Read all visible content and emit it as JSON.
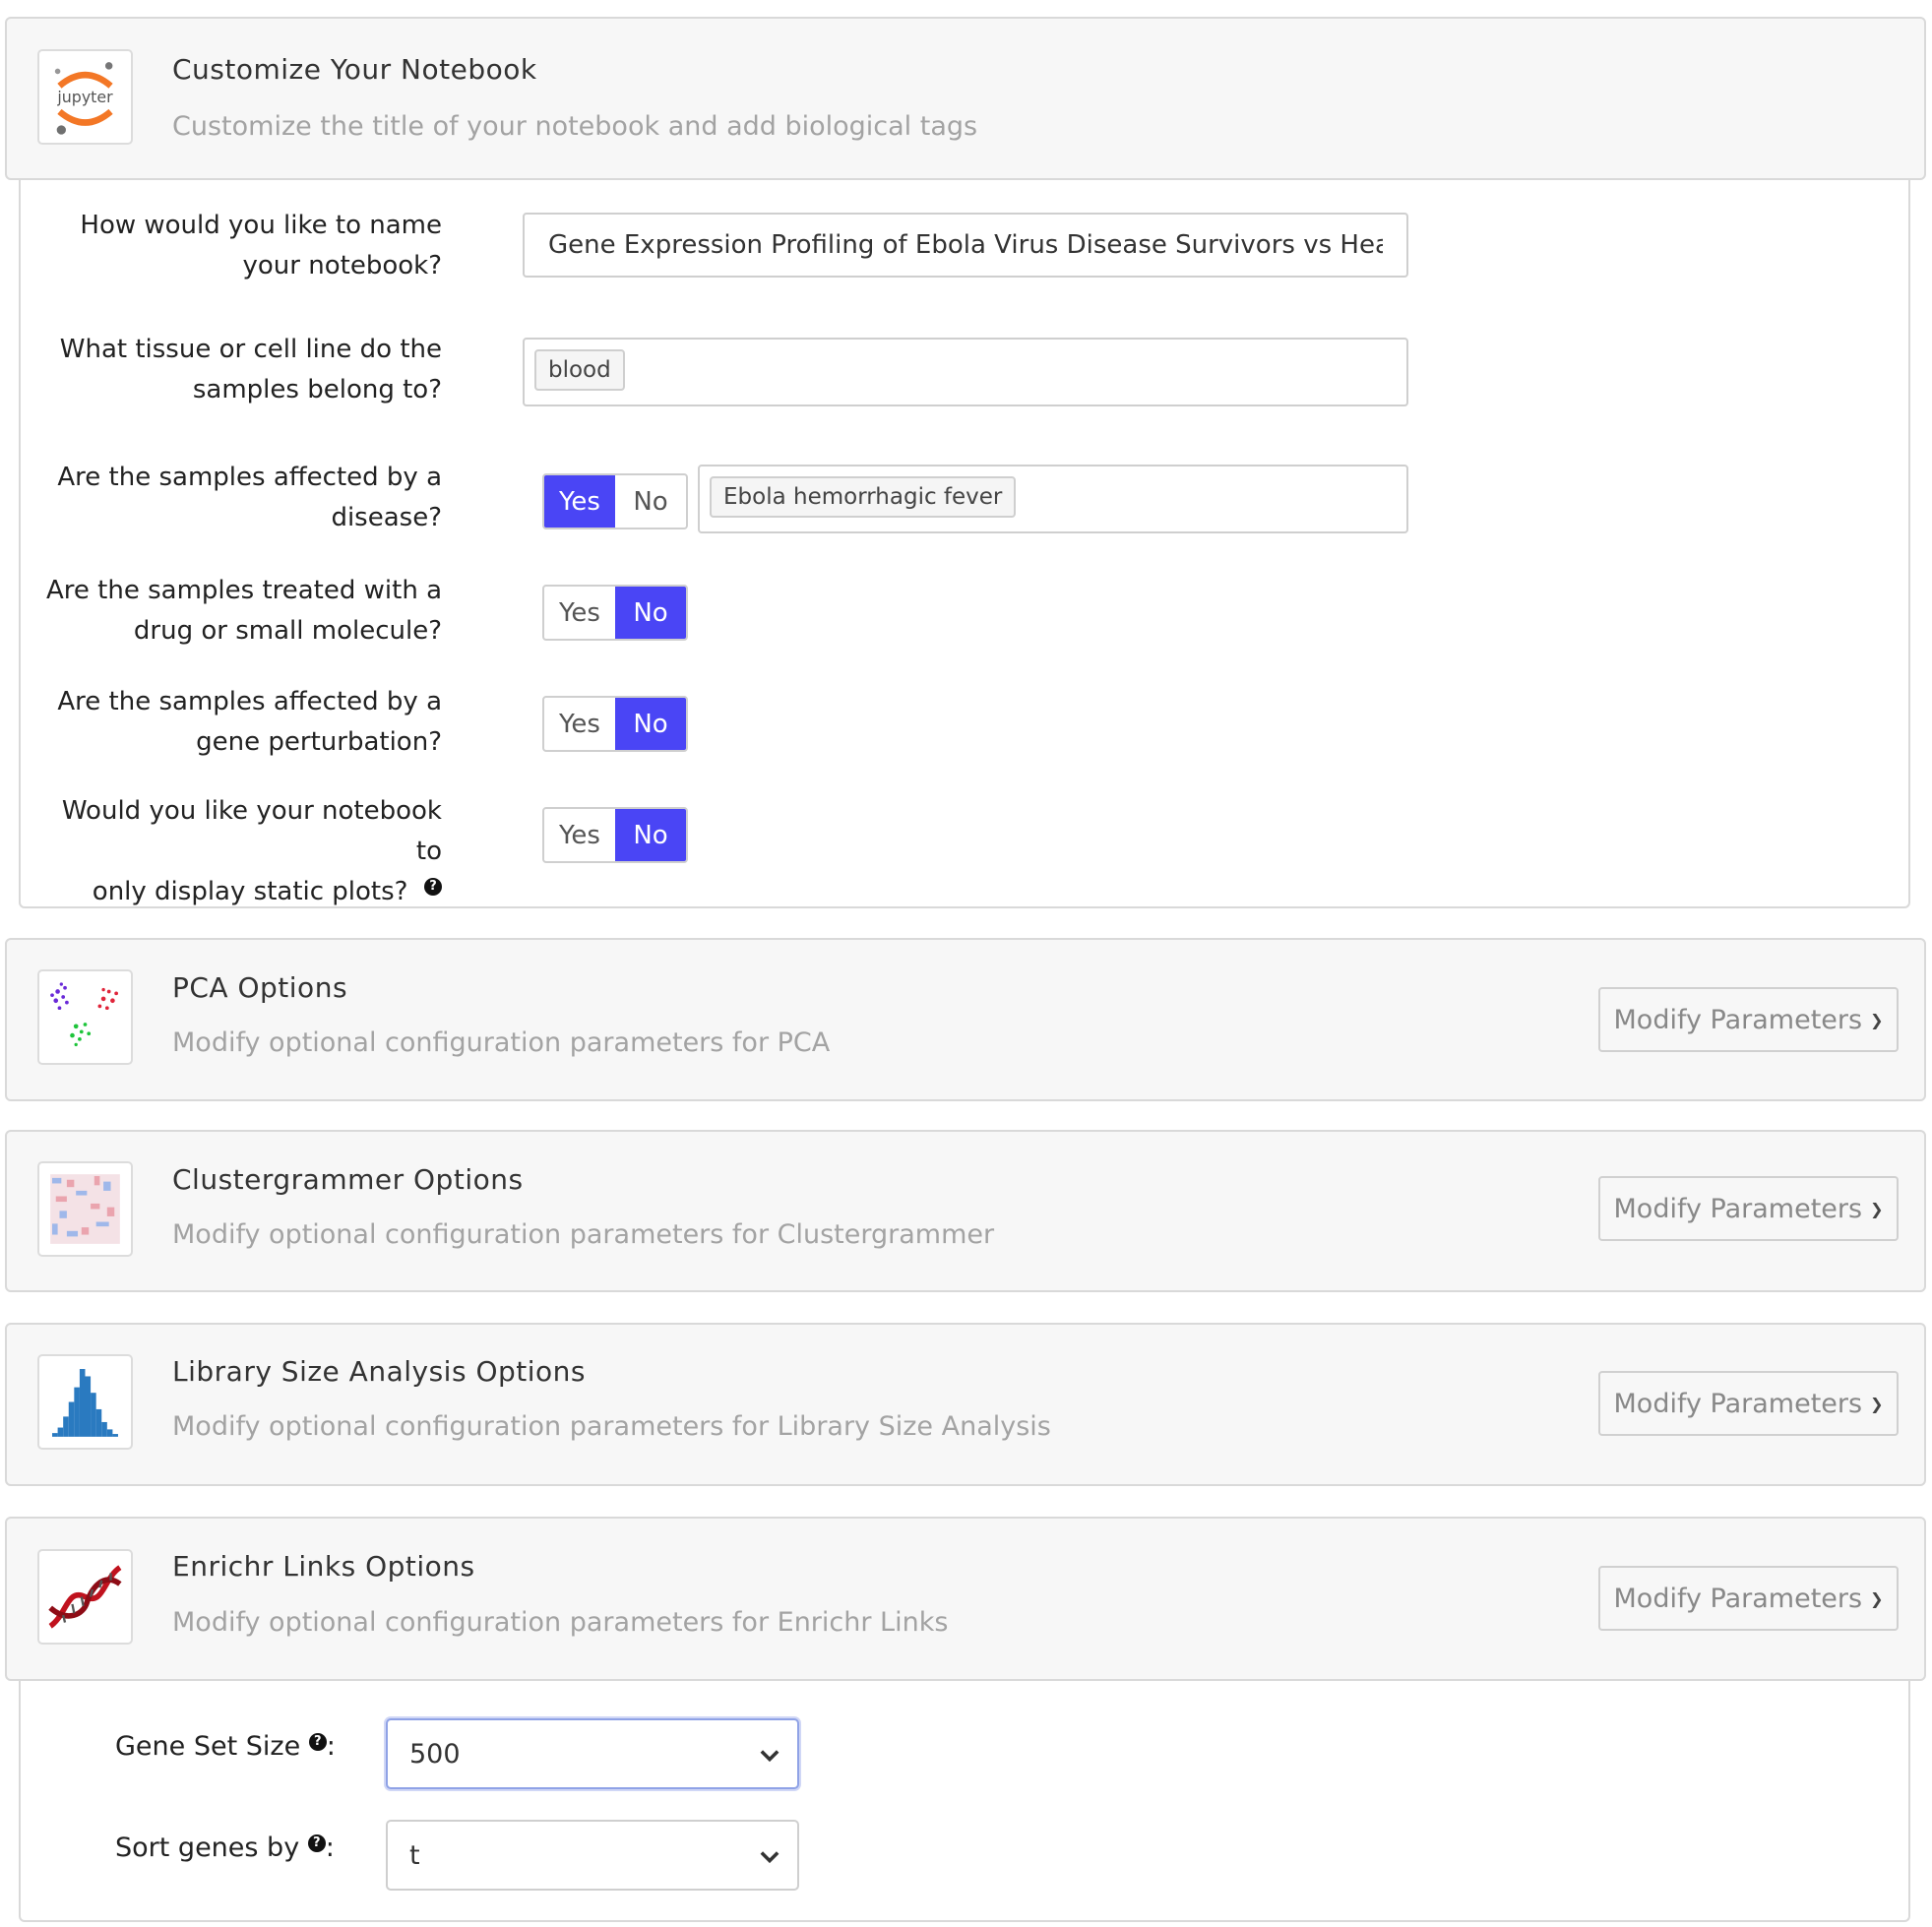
{
  "customize": {
    "title": "Customize Your Notebook",
    "subtitle": "Customize the title of your notebook and add biological tags",
    "icon_text": "jupyter",
    "questions": {
      "name": {
        "line1": "How would you like to name",
        "line2": "your notebook?",
        "value": "Gene Expression Profiling of Ebola Virus Disease Survivors vs Heal"
      },
      "tissue": {
        "line1": "What tissue or cell line do the",
        "line2": "samples belong to?",
        "tag": "blood"
      },
      "disease": {
        "line1": "Are the samples affected by a",
        "line2": "disease?",
        "yes": "Yes",
        "no": "No",
        "selected": "Yes",
        "tag": "Ebola hemorrhagic fever"
      },
      "drug": {
        "line1": "Are the samples treated with a",
        "line2": "drug or small molecule?",
        "yes": "Yes",
        "no": "No",
        "selected": "No"
      },
      "perturbation": {
        "line1": "Are the samples affected by a",
        "line2": "gene perturbation?",
        "yes": "Yes",
        "no": "No",
        "selected": "No"
      },
      "static": {
        "line1": "Would you like your notebook to",
        "line2": "only display static plots?",
        "help": "?",
        "yes": "Yes",
        "no": "No",
        "selected": "No"
      }
    }
  },
  "sections": {
    "pca": {
      "title": "PCA Options",
      "subtitle": "Modify optional configuration parameters for PCA",
      "button": "Modify Parameters"
    },
    "clustergrammer": {
      "title": "Clustergrammer Options",
      "subtitle": "Modify optional configuration parameters for Clustergrammer",
      "button": "Modify Parameters"
    },
    "library": {
      "title": "Library Size Analysis Options",
      "subtitle": "Modify optional configuration parameters for Library Size Analysis",
      "button": "Modify Parameters"
    },
    "enrichr": {
      "title": "Enrichr Links Options",
      "subtitle": "Modify optional configuration parameters for Enrichr Links",
      "button": "Modify Parameters"
    }
  },
  "enrichr_params": {
    "gene_set_size": {
      "label": "Gene Set Size",
      "suffix": ":",
      "value": "500"
    },
    "sort_genes_by": {
      "label": "Sort genes by",
      "suffix": ":",
      "value": "t"
    }
  },
  "colors": {
    "toggle_on": "#4a45f5",
    "header_bg": "#f7f7f7",
    "muted_text": "#a3a3a3"
  }
}
